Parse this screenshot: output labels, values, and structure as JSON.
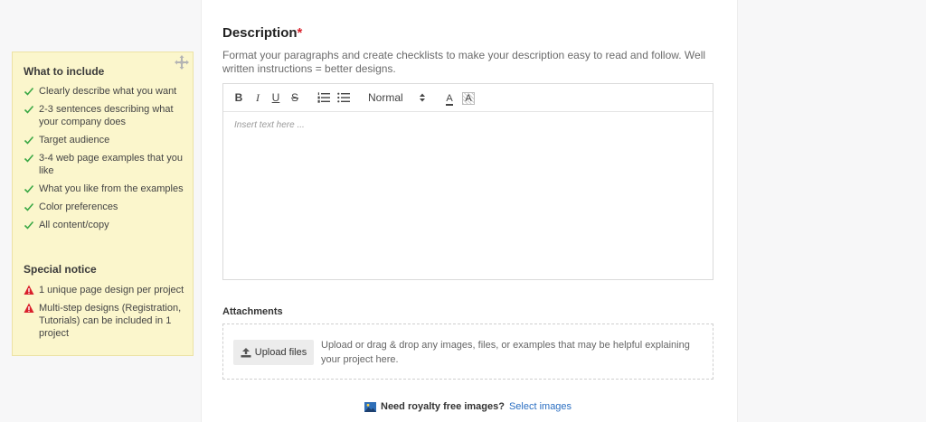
{
  "sidebar": {
    "include_heading": "What to include",
    "include_items": [
      "Clearly describe what you want",
      "2-3 sentences describing what your company does",
      "Target audience",
      "3-4 web page examples that you like",
      "What you like from the examples",
      "Color preferences",
      "All content/copy"
    ],
    "notice_heading": "Special notice",
    "notice_items": [
      "1 unique page design per project",
      "Multi-step designs (Registration, Tutorials) can be included in 1 project"
    ],
    "colors": {
      "check": "#3aa845",
      "warning": "#d9202b",
      "background": "#fbf6cc"
    }
  },
  "description": {
    "title": "Description",
    "required_marker": "*",
    "help_text": "Format your paragraphs and create checklists to make your description easy to read and follow. Well written instructions = better designs.",
    "toolbar": {
      "bold": "B",
      "italic": "I",
      "underline": "U",
      "strike": "S",
      "ordered_list_icon": "ordered-list-icon",
      "bullet_list_icon": "bullet-list-icon",
      "size_value": "Normal",
      "text_color": "A",
      "background_color": "A"
    },
    "placeholder": "Insert text here ..."
  },
  "attachments": {
    "label": "Attachments",
    "upload_button": "Upload files",
    "drop_text": "Upload or drag & drop any images, files, or examples that may be helpful explaining your project here."
  },
  "royalty": {
    "question": "Need royalty free images?",
    "link": "Select images"
  },
  "accent_color": "#2b6fc2"
}
